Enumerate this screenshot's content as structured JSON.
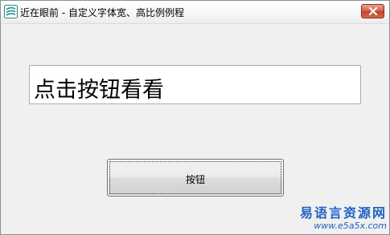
{
  "window": {
    "title": "近在眼前 - 自定义字体宽、高比例例程"
  },
  "textbox": {
    "value": "点击按钮看看"
  },
  "button": {
    "label": "按钮"
  },
  "watermark": {
    "site_name": "易语言资源网",
    "url": "www.e5a5x.com"
  },
  "icons": {
    "app": "app-logo-icon",
    "close": "close-icon"
  },
  "colors": {
    "close_button": "#c8442e",
    "watermark": "#1e63c6"
  }
}
